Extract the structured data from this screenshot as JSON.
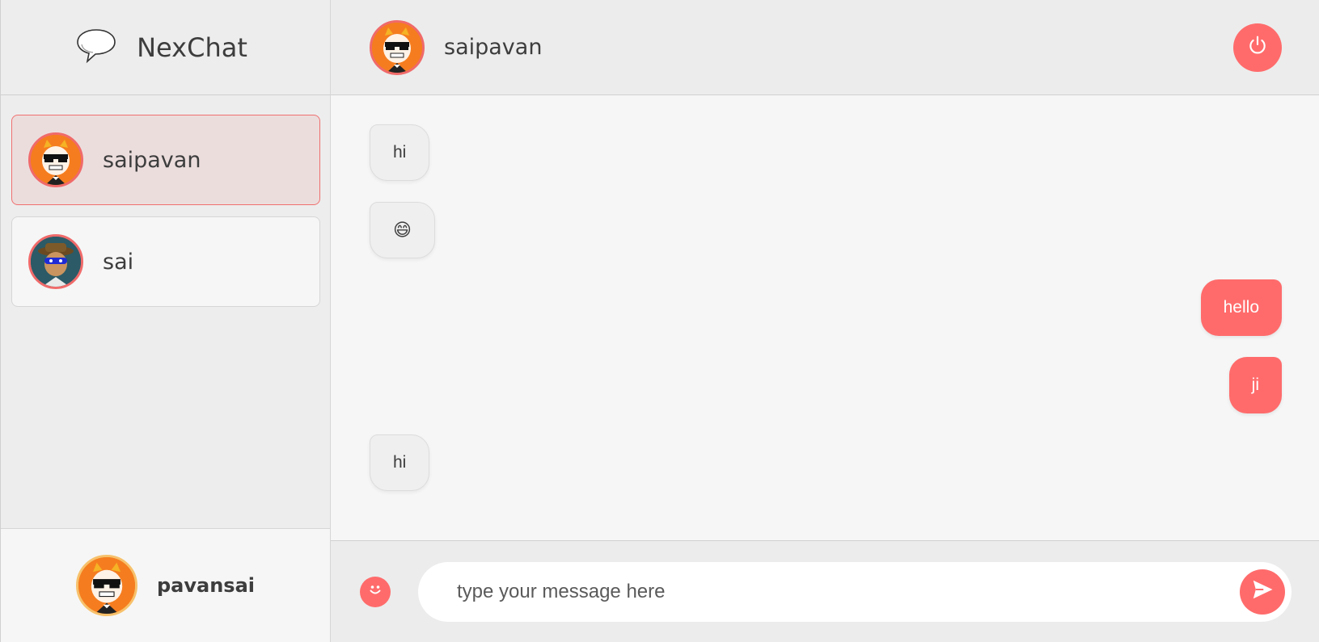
{
  "app": {
    "name": "NexChat"
  },
  "contacts": [
    {
      "name": "saipavan",
      "avatar": "cat-sunglasses-avatar",
      "active": true
    },
    {
      "name": "sai",
      "avatar": "cowboy-masked-avatar",
      "active": false
    }
  ],
  "current_user": {
    "name": "pavansai",
    "avatar": "cat-sunglasses-avatar"
  },
  "chat": {
    "contact_name": "saipavan",
    "messages": [
      {
        "direction": "in",
        "text": "hi"
      },
      {
        "direction": "in",
        "text": "😄"
      },
      {
        "direction": "out",
        "text": "hello"
      },
      {
        "direction": "out",
        "text": "ji"
      },
      {
        "direction": "in",
        "text": "hi"
      }
    ]
  },
  "composer": {
    "placeholder": "type your message here"
  },
  "icons": {
    "logo": "speech-bubble-icon",
    "logout": "power-icon",
    "emoji": "smiley-icon",
    "send": "send-icon"
  },
  "colors": {
    "accent": "#ff6b6b",
    "sidebar_bg": "#ededed",
    "chat_bg": "#f6f6f6"
  }
}
